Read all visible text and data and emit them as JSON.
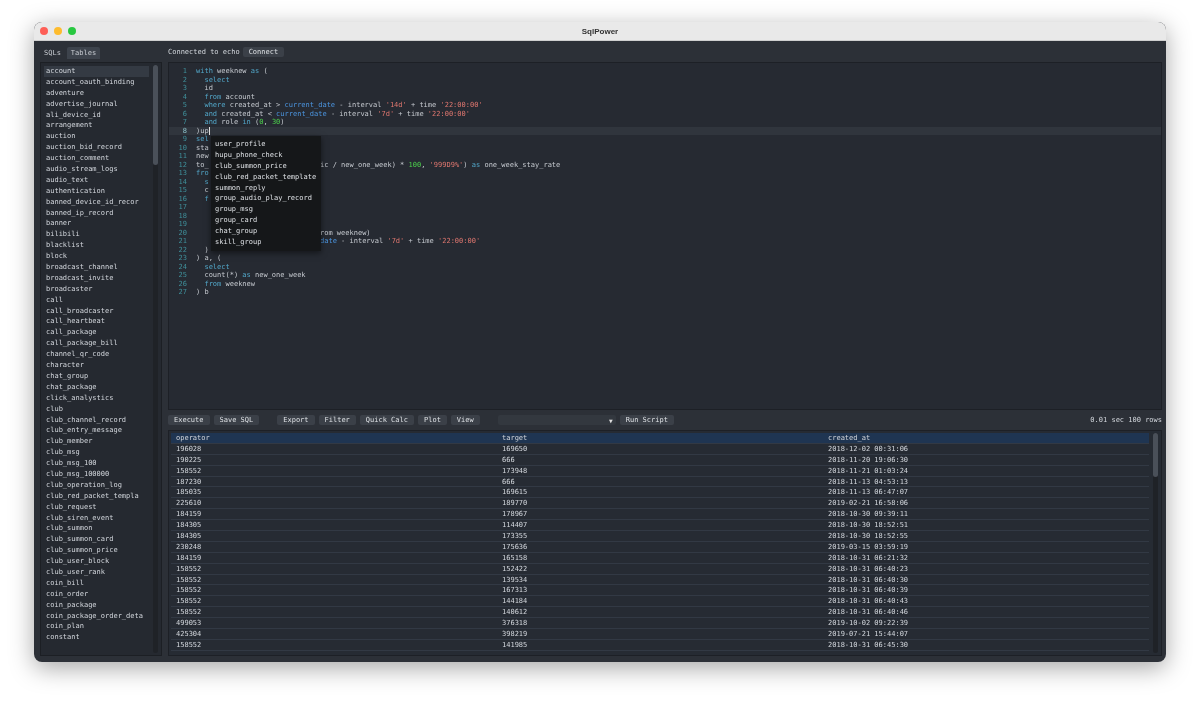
{
  "window": {
    "title": "SqlPower"
  },
  "sidebar": {
    "tabs": [
      {
        "label": "SQLs",
        "selected": false
      },
      {
        "label": "Tables",
        "selected": true
      }
    ],
    "items": [
      {
        "label": "account",
        "selected": true
      },
      {
        "label": "account_oauth_binding",
        "selected": false
      },
      {
        "label": "adventure",
        "selected": false
      },
      {
        "label": "advertise_journal",
        "selected": false
      },
      {
        "label": "ali_device_id",
        "selected": false
      },
      {
        "label": "arrangement",
        "selected": false
      },
      {
        "label": "auction",
        "selected": false
      },
      {
        "label": "auction_bid_record",
        "selected": false
      },
      {
        "label": "auction_comment",
        "selected": false
      },
      {
        "label": "audio_stream_logs",
        "selected": false
      },
      {
        "label": "audio_text",
        "selected": false
      },
      {
        "label": "authentication",
        "selected": false
      },
      {
        "label": "banned_device_id_recor",
        "selected": false
      },
      {
        "label": "banned_ip_record",
        "selected": false
      },
      {
        "label": "banner",
        "selected": false
      },
      {
        "label": "bilibili",
        "selected": false
      },
      {
        "label": "blacklist",
        "selected": false
      },
      {
        "label": "block",
        "selected": false
      },
      {
        "label": "broadcast_channel",
        "selected": false
      },
      {
        "label": "broadcast_invite",
        "selected": false
      },
      {
        "label": "broadcaster",
        "selected": false
      },
      {
        "label": "call",
        "selected": false
      },
      {
        "label": "call_broadcaster",
        "selected": false
      },
      {
        "label": "call_heartbeat",
        "selected": false
      },
      {
        "label": "call_package",
        "selected": false
      },
      {
        "label": "call_package_bill",
        "selected": false
      },
      {
        "label": "channel_qr_code",
        "selected": false
      },
      {
        "label": "character",
        "selected": false
      },
      {
        "label": "chat_group",
        "selected": false
      },
      {
        "label": "chat_package",
        "selected": false
      },
      {
        "label": "click_analystics",
        "selected": false
      },
      {
        "label": "club",
        "selected": false
      },
      {
        "label": "club_channel_record",
        "selected": false
      },
      {
        "label": "club_entry_message",
        "selected": false
      },
      {
        "label": "club_member",
        "selected": false
      },
      {
        "label": "club_msg",
        "selected": false
      },
      {
        "label": "club_msg_100",
        "selected": false
      },
      {
        "label": "club_msg_100000",
        "selected": false
      },
      {
        "label": "club_operation_log",
        "selected": false
      },
      {
        "label": "club_red_packet_templa",
        "selected": false
      },
      {
        "label": "club_request",
        "selected": false
      },
      {
        "label": "club_siren_event",
        "selected": false
      },
      {
        "label": "club_summon",
        "selected": false
      },
      {
        "label": "club_summon_card",
        "selected": false
      },
      {
        "label": "club_summon_price",
        "selected": false
      },
      {
        "label": "club_user_block",
        "selected": false
      },
      {
        "label": "club_user_rank",
        "selected": false
      },
      {
        "label": "coin_bill",
        "selected": false
      },
      {
        "label": "coin_order",
        "selected": false
      },
      {
        "label": "coin_package",
        "selected": false
      },
      {
        "label": "coin_package_order_deta",
        "selected": false
      },
      {
        "label": "coin_plan",
        "selected": false
      },
      {
        "label": "constant",
        "selected": false
      }
    ]
  },
  "connection": {
    "status": "Connected to echo",
    "button": "Connect"
  },
  "editor": {
    "lines": [
      {
        "number": "1",
        "current": false,
        "indented": false,
        "tokens": [
          {
            "kind": "keyword",
            "text": "with"
          },
          {
            "kind": "plain",
            "text": " weeknew "
          },
          {
            "kind": "keyword",
            "text": "as"
          },
          {
            "kind": "plain",
            "text": " ("
          }
        ]
      },
      {
        "number": "2",
        "current": false,
        "indented": true,
        "tokens": [
          {
            "kind": "keyword",
            "text": "select"
          }
        ]
      },
      {
        "number": "3",
        "current": false,
        "indented": true,
        "tokens": [
          {
            "kind": "plain",
            "text": "id"
          }
        ]
      },
      {
        "number": "4",
        "current": false,
        "indented": true,
        "tokens": [
          {
            "kind": "keyword",
            "text": "from"
          },
          {
            "kind": "plain",
            "text": " account"
          }
        ]
      },
      {
        "number": "5",
        "current": false,
        "indented": true,
        "tokens": [
          {
            "kind": "keyword",
            "text": "where"
          },
          {
            "kind": "plain",
            "text": " created_at > "
          },
          {
            "kind": "function",
            "text": "current_date"
          },
          {
            "kind": "plain",
            "text": " - interval "
          },
          {
            "kind": "string",
            "text": "'14d'"
          },
          {
            "kind": "plain",
            "text": " + time "
          },
          {
            "kind": "string",
            "text": "'22:00:00'"
          }
        ]
      },
      {
        "number": "6",
        "current": false,
        "indented": true,
        "tokens": [
          {
            "kind": "keyword",
            "text": "and"
          },
          {
            "kind": "plain",
            "text": " created_at < "
          },
          {
            "kind": "function",
            "text": "current_date"
          },
          {
            "kind": "plain",
            "text": " - interval "
          },
          {
            "kind": "string",
            "text": "'7d'"
          },
          {
            "kind": "plain",
            "text": " + time "
          },
          {
            "kind": "string",
            "text": "'22:00:00'"
          }
        ]
      },
      {
        "number": "7",
        "current": false,
        "indented": true,
        "tokens": [
          {
            "kind": "keyword",
            "text": "and"
          },
          {
            "kind": "plain",
            "text": " role "
          },
          {
            "kind": "keyword",
            "text": "in"
          },
          {
            "kind": "plain",
            "text": " ("
          },
          {
            "kind": "number",
            "text": "0"
          },
          {
            "kind": "plain",
            "text": ", "
          },
          {
            "kind": "number",
            "text": "30"
          },
          {
            "kind": "plain",
            "text": ")"
          }
        ]
      },
      {
        "number": "8",
        "current": true,
        "indented": false,
        "tokens": [
          {
            "kind": "plain",
            "text": ")up"
          }
        ]
      },
      {
        "number": "9",
        "current": false,
        "indented": false,
        "tokens": [
          {
            "kind": "keyword",
            "text": "sel"
          }
        ]
      },
      {
        "number": "10",
        "current": false,
        "indented": false,
        "tokens": [
          {
            "kind": "plain",
            "text": "sta"
          }
        ]
      },
      {
        "number": "11",
        "current": false,
        "indented": false,
        "tokens": [
          {
            "kind": "plain",
            "text": "new"
          }
        ]
      },
      {
        "number": "12",
        "current": false,
        "indented": false,
        "tokens": [
          {
            "kind": "plain",
            "text": "to_"
          }
        ],
        "tail": [
          {
            "kind": "plain",
            "text": "ic / new_one_week) * "
          },
          {
            "kind": "number",
            "text": "100"
          },
          {
            "kind": "plain",
            "text": ", "
          },
          {
            "kind": "string",
            "text": "'999D9%'"
          },
          {
            "kind": "plain",
            "text": ") "
          },
          {
            "kind": "keyword",
            "text": "as"
          },
          {
            "kind": "plain",
            "text": " one_week_stay_rate"
          }
        ]
      },
      {
        "number": "13",
        "current": false,
        "indented": false,
        "tokens": [
          {
            "kind": "keyword",
            "text": "fro"
          }
        ]
      },
      {
        "number": "14",
        "current": false,
        "indented": true,
        "tokens": [
          {
            "kind": "keyword",
            "text": "s"
          }
        ]
      },
      {
        "number": "15",
        "current": false,
        "indented": true,
        "tokens": [
          {
            "kind": "plain",
            "text": "c"
          }
        ]
      },
      {
        "number": "16",
        "current": false,
        "indented": true,
        "tokens": [
          {
            "kind": "keyword",
            "text": "f"
          }
        ]
      },
      {
        "number": "17",
        "current": false
      },
      {
        "number": "18",
        "current": false
      },
      {
        "number": "19",
        "current": false
      },
      {
        "number": "20",
        "current": false,
        "tail": [
          {
            "kind": "plain",
            "text": "rom weeknew)"
          }
        ]
      },
      {
        "number": "21",
        "current": false,
        "tail": [
          {
            "kind": "function",
            "text": "date"
          },
          {
            "kind": "plain",
            "text": " - interval "
          },
          {
            "kind": "string",
            "text": "'7d'"
          },
          {
            "kind": "plain",
            "text": " + time "
          },
          {
            "kind": "string",
            "text": "'22:00:00'"
          }
        ]
      },
      {
        "number": "22",
        "current": false,
        "indented": true,
        "tokens": [
          {
            "kind": "plain",
            "text": ")"
          }
        ]
      },
      {
        "number": "23",
        "current": false,
        "indented": false,
        "tokens": [
          {
            "kind": "plain",
            "text": ") a, ("
          }
        ]
      },
      {
        "number": "24",
        "current": false,
        "indented": true,
        "tokens": [
          {
            "kind": "keyword",
            "text": "select"
          }
        ]
      },
      {
        "number": "25",
        "current": false,
        "indented": true,
        "tokens": [
          {
            "kind": "plain",
            "text": "count(*) "
          },
          {
            "kind": "keyword",
            "text": "as"
          },
          {
            "kind": "plain",
            "text": " new_one_week"
          }
        ]
      },
      {
        "number": "26",
        "current": false,
        "indented": true,
        "tokens": [
          {
            "kind": "keyword",
            "text": "from"
          },
          {
            "kind": "plain",
            "text": " weeknew"
          }
        ]
      },
      {
        "number": "27",
        "current": false,
        "indented": false,
        "tokens": [
          {
            "kind": "plain",
            "text": ") b"
          }
        ]
      }
    ],
    "completions": [
      "user_profile",
      "hupu_phone_check",
      "club_summon_price",
      "club_red_packet_template",
      "summon_reply",
      "group_audio_play_record",
      "group_msg",
      "group_card",
      "chat_group",
      "skill_group"
    ]
  },
  "toolbar": {
    "left_buttons": [
      "Execute",
      "Save SQL"
    ],
    "middle_buttons": [
      "Export",
      "Filter",
      "Quick Calc",
      "Plot",
      "View"
    ],
    "dropdown": {
      "arrow": "▼"
    },
    "run_button": "Run Script",
    "status": "0.01 sec 100 rows"
  },
  "table": {
    "columns": [
      "operator",
      "target",
      "created_at"
    ],
    "rows": [
      [
        "196028",
        "169650",
        "2018-12-02 00:31:06"
      ],
      [
        "190225",
        "666",
        "2018-11-20 19:06:30"
      ],
      [
        "158552",
        "173948",
        "2018-11-21 01:03:24"
      ],
      [
        "187230",
        "666",
        "2018-11-13 04:53:13"
      ],
      [
        "185035",
        "169615",
        "2018-11-13 06:47:07"
      ],
      [
        "225610",
        "189770",
        "2019-02-21 16:58:06"
      ],
      [
        "184159",
        "178967",
        "2018-10-30 09:39:11"
      ],
      [
        "184305",
        "114407",
        "2018-10-30 18:52:51"
      ],
      [
        "184305",
        "173355",
        "2018-10-30 18:52:55"
      ],
      [
        "230248",
        "175636",
        "2019-03-15 03:59:19"
      ],
      [
        "184159",
        "165158",
        "2018-10-31 06:21:32"
      ],
      [
        "158552",
        "152422",
        "2018-10-31 06:40:23"
      ],
      [
        "158552",
        "139534",
        "2018-10-31 06:40:30"
      ],
      [
        "158552",
        "167313",
        "2018-10-31 06:40:39"
      ],
      [
        "158552",
        "144184",
        "2018-10-31 06:40:43"
      ],
      [
        "158552",
        "140612",
        "2018-10-31 06:40:46"
      ],
      [
        "499053",
        "376318",
        "2019-10-02 09:22:39"
      ],
      [
        "425304",
        "398219",
        "2019-07-21 15:44:07"
      ],
      [
        "158552",
        "141985",
        "2018-10-31 06:45:30"
      ]
    ]
  }
}
